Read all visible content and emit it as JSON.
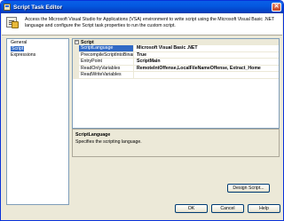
{
  "window": {
    "title": "Script Task Editor"
  },
  "header": {
    "description": "Access the Microsoft Visual Studio for Applications (VSA) environment to write script using the Microsoft Visual Basic .NET language and configure the Script task properties to run the custom script."
  },
  "nav": {
    "items": [
      "General",
      "Script",
      "Expressions"
    ],
    "selected": "Script"
  },
  "grid": {
    "category": "Script",
    "rows": [
      {
        "name": "ScriptLanguage",
        "value": "Microsoft Visual Basic .NET"
      },
      {
        "name": "PrecompileScriptIntoBinaryCo",
        "value": "True"
      },
      {
        "name": "EntryPoint",
        "value": "ScriptMain"
      },
      {
        "name": "ReadOnlyVariables",
        "value": "RemoteIntOffense,LocalFileNameOffense, Extract_Home"
      },
      {
        "name": "ReadWriteVariables",
        "value": ""
      }
    ]
  },
  "description_panel": {
    "title": "ScriptLanguage",
    "text": "Specifies the scripting language."
  },
  "buttons": {
    "design": "Design Script...",
    "ok": "OK",
    "cancel": "Cancel",
    "help": "Help"
  }
}
